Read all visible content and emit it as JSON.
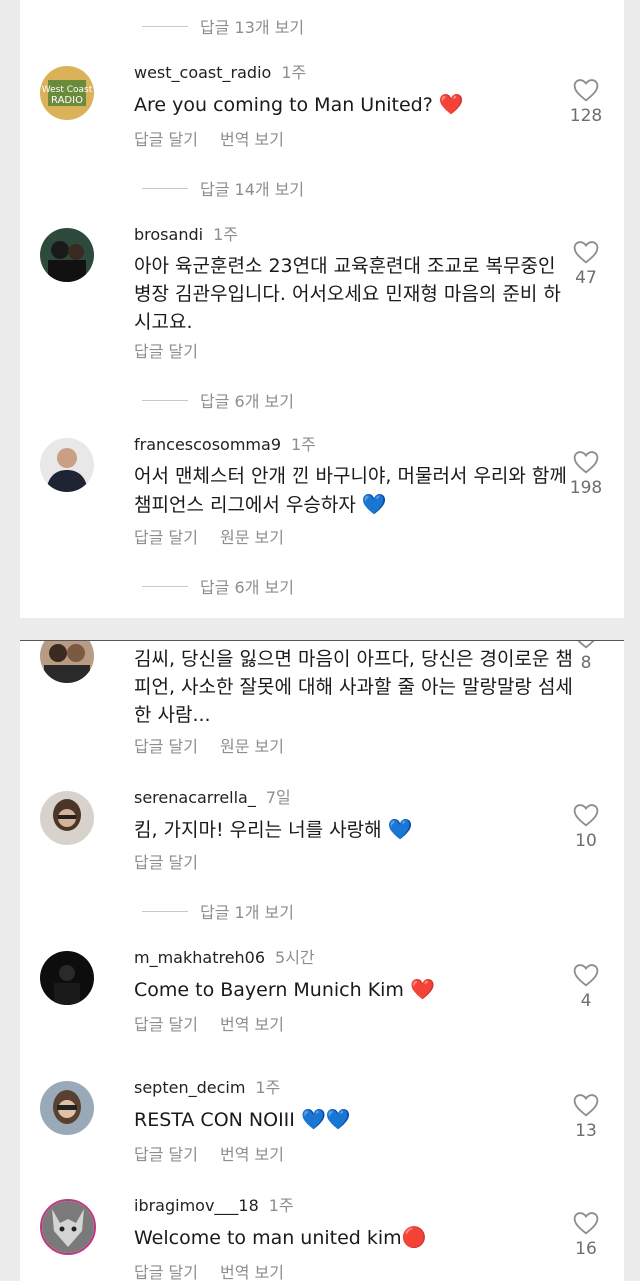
{
  "panel1": {
    "replies_top": "답글 13개 보기",
    "comments": [
      {
        "username": "west_coast_radio",
        "time": "1주",
        "text": "Are you coming to Man United?",
        "emoji": "❤️",
        "emoji_color": "#e0245e",
        "actions": [
          "답글 달기",
          "번역 보기"
        ],
        "likes": "128",
        "replies": "답글 14개 보기"
      },
      {
        "username": "brosandi",
        "time": "1주",
        "text": "아아 육군훈련소 23연대 교육훈련대 조교로 복무중인 병장 김관우입니다. 어서오세요 민재형 마음의 준비 하시고요.",
        "emoji": "",
        "actions": [
          "답글 달기"
        ],
        "likes": "47",
        "replies": "답글 6개 보기"
      },
      {
        "username": "francescosomma9",
        "time": "1주",
        "text": "어서 맨체스터 안개 낀 바구니야, 머물러서 우리와 함께 챔피언스 리그에서 우승하자",
        "emoji": "💙",
        "emoji_color": "#1b8fe0",
        "actions": [
          "답글 달기",
          "원문 보기"
        ],
        "likes": "198",
        "replies": "답글 6개 보기"
      }
    ]
  },
  "panel2": {
    "comments": [
      {
        "username": "",
        "time": "",
        "text": "김씨, 당신을 잃으면 마음이 아프다, 당신은 경이로운 챔피언, 사소한 잘못에 대해 사과할 줄 아는 말랑말랑 섬세한 사람...",
        "emoji": "",
        "actions": [
          "답글 달기",
          "원문 보기"
        ],
        "likes": "8",
        "replies": ""
      },
      {
        "username": "serenacarrella_",
        "time": "7일",
        "text": "킴, 가지마! 우리는 너를 사랑해",
        "emoji": "💙",
        "emoji_color": "#1b8fe0",
        "actions": [
          "답글 달기"
        ],
        "likes": "10",
        "replies": "답글 1개 보기"
      },
      {
        "username": "m_makhatreh06",
        "time": "5시간",
        "text": "Come to Bayern Munich Kim",
        "emoji": "❤️",
        "emoji_color": "#e0245e",
        "actions": [
          "답글 달기",
          "번역 보기"
        ],
        "likes": "4",
        "replies": ""
      },
      {
        "username": "septen_decim",
        "time": "1주",
        "text": "RESTA CON NOIII",
        "emoji": "💙💙",
        "emoji_color": "#1b8fe0",
        "actions": [
          "답글 달기",
          "번역 보기"
        ],
        "likes": "13",
        "replies": ""
      },
      {
        "username": "ibragimov___18",
        "time": "1주",
        "text": "Welcome to man united kim",
        "emoji": "🔴",
        "emoji_color": "#d81e1e",
        "actions": [
          "답글 달기",
          "번역 보기"
        ],
        "likes": "16",
        "replies": ""
      }
    ]
  },
  "icons": {
    "like": "heart-outline-icon"
  }
}
